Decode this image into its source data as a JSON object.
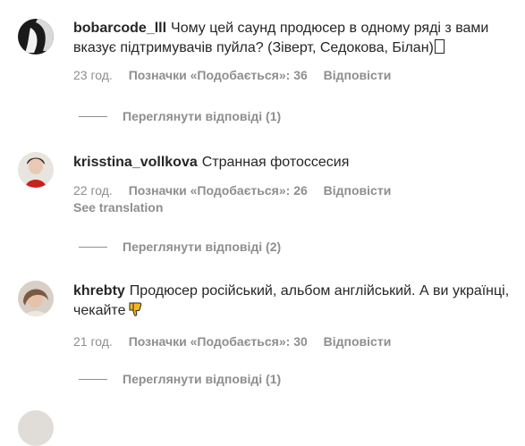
{
  "comments": [
    {
      "username": "bobarcode_lll",
      "text": "Чому цей саунд продюсер в одному ряді з вами вказує підтримувачів пуйла? (Зіверт, Седокова, Білан)",
      "time": "23 год.",
      "likes": "Позначки «Подобається»: 36",
      "reply": "Відповісти",
      "view_replies": "Переглянути відповіді (1)"
    },
    {
      "username": "krisstina_vollkova",
      "text": "Странная фотоссесия",
      "time": "22 год.",
      "likes": "Позначки «Подобається»: 26",
      "reply": "Відповісти",
      "see_translation": "See translation",
      "view_replies": "Переглянути відповіді (2)"
    },
    {
      "username": "khrebty",
      "text": "Продюсер російський, альбом англійський. А ви українці, чекайте",
      "time": "21 год.",
      "likes": "Позначки «Подобається»: 30",
      "reply": "Відповісти",
      "view_replies": "Переглянути відповіді (1)"
    }
  ],
  "icons": {
    "comment1_trailing": "replacement-box-glyph",
    "comment3_emoji": "thumbs-down-emoji"
  },
  "colors": {
    "text": "#262626",
    "secondary": "#8e8e8e",
    "background": "#ffffff"
  }
}
